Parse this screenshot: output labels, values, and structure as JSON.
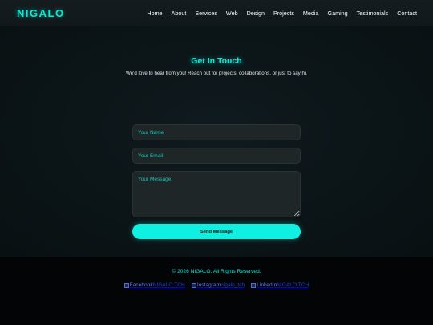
{
  "header": {
    "logo": "NIGALO",
    "nav": [
      "Home",
      "About",
      "Services",
      "Web",
      "Design",
      "Projects",
      "Media",
      "Gaming",
      "Testimonials",
      "Contact"
    ]
  },
  "contact": {
    "title": "Get In Touch",
    "subtitle": "We'd love to hear from you! Reach out for projects, collaborations, or just to say hi.",
    "name_placeholder": "Your Name",
    "email_placeholder": "Your Email",
    "message_placeholder": "Your Message",
    "send_label": "Send Message"
  },
  "footer": {
    "copyright": "© 2026 NIGALO. All Rights Reserved.",
    "social": [
      {
        "alt": "Facebook",
        "handle": "NIGALO TCH",
        "icon": "facebook-icon"
      },
      {
        "alt": "Instagram",
        "handle": "nigalo_tch",
        "icon": "instagram-icon"
      },
      {
        "alt": "LinkedIn",
        "handle": "NIGALO TCH",
        "icon": "linkedin-icon"
      }
    ]
  },
  "colors": {
    "accent": "#12e6d4",
    "button": "#10f0e0",
    "background": "#0b1215",
    "footer": "#030405"
  }
}
